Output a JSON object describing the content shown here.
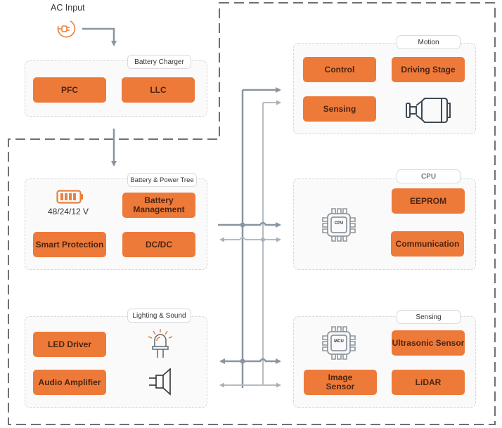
{
  "colors": {
    "block_fill": "#ee7a3a",
    "block_text": "#4a2512",
    "accent_icon": "#e8813f",
    "line": "#8a95a0",
    "line_light": "#b5bcc3",
    "frame": "#6b7177"
  },
  "ac_input": {
    "label": "AC Input",
    "icon": "power-plug-icon"
  },
  "battery_charger": {
    "tag": "Battery Charger",
    "blocks": [
      "PFC",
      "LLC"
    ]
  },
  "battery_power_tree": {
    "tag": "Battery & Power Tree",
    "voltage_label": "48/24/12 V",
    "icon": "battery-icon",
    "blocks": [
      "Battery Management",
      "Smart Protection",
      "DC/DC"
    ]
  },
  "lighting_sound": {
    "tag": "Lighting & Sound",
    "blocks": [
      "LED Driver",
      "Audio Amplifier"
    ],
    "icons": [
      "led-icon",
      "speaker-icon"
    ]
  },
  "motion": {
    "tag": "Motion",
    "blocks": [
      "Control",
      "Driving Stage",
      "Sensing"
    ],
    "icon": "motor-icon"
  },
  "cpu": {
    "tag": "CPU",
    "chip_label": "CPU",
    "blocks": [
      "EEPROM",
      "Communication"
    ]
  },
  "sensing": {
    "tag": "Sensing",
    "chip_label": "MCU",
    "blocks": [
      "Ultrasonic Sensor",
      "Image Sensor",
      "LiDAR"
    ]
  }
}
